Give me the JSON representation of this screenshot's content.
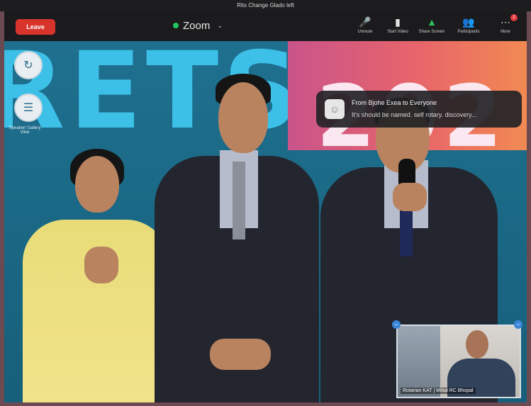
{
  "window": {
    "title": "Rits Change Glado left"
  },
  "toolbar": {
    "leave_label": "Leave",
    "meeting_title": "Zoom",
    "buttons": [
      {
        "label": "Unmute",
        "icon": "microphone-muted-icon"
      },
      {
        "label": "Start Video",
        "icon": "video-icon"
      },
      {
        "label": "Share Screen",
        "icon": "share-screen-icon"
      },
      {
        "label": "Participants",
        "icon": "participants-icon"
      },
      {
        "label": "More",
        "icon": "more-icon"
      }
    ],
    "more_badge": "2"
  },
  "stage": {
    "backdrop_text": "RETS",
    "year_text": "202"
  },
  "side_controls": {
    "grid_label": "Speaker/ Gallery View"
  },
  "chat": {
    "from": "From Bjohe Exea to Everyone",
    "message": "It's should be named. self rotary. discovery..."
  },
  "pip": {
    "name": "Rotarian KAT | Mittal RC Bhopal"
  },
  "colors": {
    "leave": "#d9342b",
    "accent_green": "#22c55e",
    "stage_bg": "#1b6a87",
    "backdrop_text": "#3dc0e8"
  }
}
